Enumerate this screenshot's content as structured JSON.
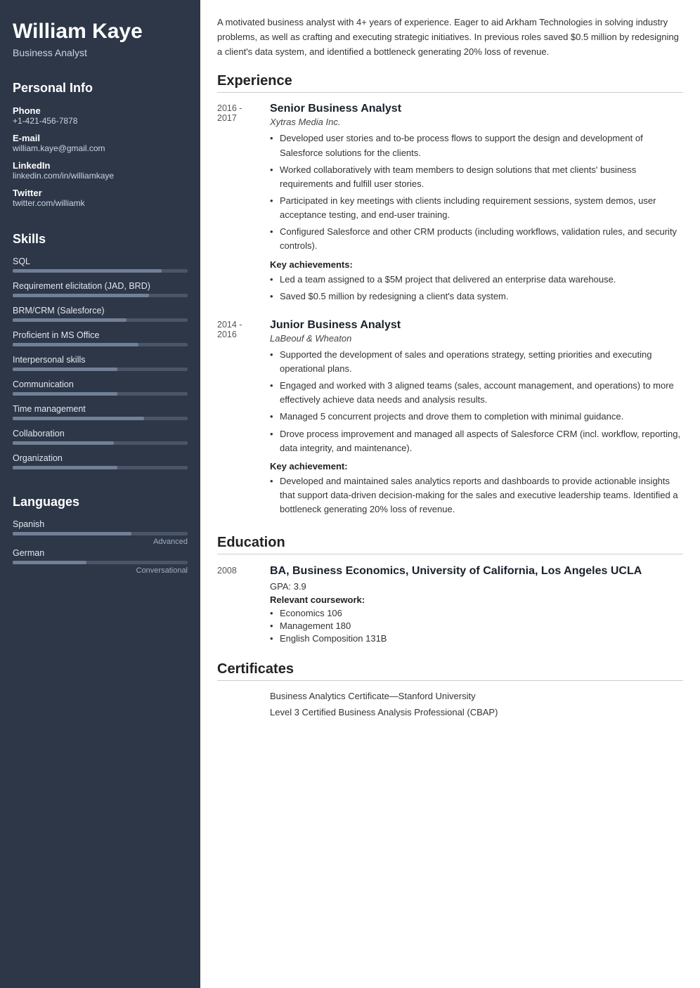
{
  "sidebar": {
    "name": "William Kaye",
    "title": "Business Analyst",
    "sections": {
      "personal_info": {
        "title": "Personal Info",
        "items": [
          {
            "label": "Phone",
            "value": "+1-421-456-7878"
          },
          {
            "label": "E-mail",
            "value": "william.kaye@gmail.com"
          },
          {
            "label": "LinkedIn",
            "value": "linkedin.com/in/williamkaye"
          },
          {
            "label": "Twitter",
            "value": "twitter.com/williamk"
          }
        ]
      },
      "skills": {
        "title": "Skills",
        "items": [
          {
            "name": "SQL",
            "fill_pct": 85
          },
          {
            "name": "Requirement elicitation (JAD, BRD)",
            "fill_pct": 78
          },
          {
            "name": "BRM/CRM (Salesforce)",
            "fill_pct": 65
          },
          {
            "name": "Proficient in MS Office",
            "fill_pct": 72
          },
          {
            "name": "Interpersonal skills",
            "fill_pct": 60
          },
          {
            "name": "Communication",
            "fill_pct": 60
          },
          {
            "name": "Time management",
            "fill_pct": 75
          },
          {
            "name": "Collaboration",
            "fill_pct": 58
          },
          {
            "name": "Organization",
            "fill_pct": 60
          }
        ]
      },
      "languages": {
        "title": "Languages",
        "items": [
          {
            "name": "Spanish",
            "fill_pct": 68,
            "level": "Advanced"
          },
          {
            "name": "German",
            "fill_pct": 42,
            "level": "Conversational"
          }
        ]
      }
    }
  },
  "main": {
    "summary": "A motivated business analyst with 4+ years of experience. Eager to aid Arkham Technologies in solving industry problems, as well as crafting and executing strategic initiatives. In previous roles saved $0.5 million by redesigning a client's data system, and identified a bottleneck generating 20% loss of revenue.",
    "experience": {
      "title": "Experience",
      "entries": [
        {
          "date_start": "2016 -",
          "date_end": "2017",
          "job_title": "Senior Business Analyst",
          "company": "Xytras Media Inc.",
          "bullets": [
            "Developed user stories and to-be process flows to support the design and development of Salesforce solutions for the clients.",
            "Worked collaboratively with team members to design solutions that met clients' business requirements and fulfill user stories.",
            "Participated in key meetings with clients including requirement sessions, system demos, user acceptance testing, and end-user training.",
            "Configured Salesforce and other CRM products (including workflows, validation rules, and security controls)."
          ],
          "achievements_title": "Key achievements:",
          "achievements": [
            "Led a team assigned to a $5M project that delivered an enterprise data warehouse.",
            "Saved $0.5 million by redesigning a client's data system."
          ]
        },
        {
          "date_start": "2014 -",
          "date_end": "2016",
          "job_title": "Junior Business Analyst",
          "company": "LaBeouf & Wheaton",
          "bullets": [
            "Supported the development of sales and operations strategy, setting priorities and executing operational plans.",
            "Engaged and worked with 3 aligned teams (sales, account management, and operations) to more effectively achieve data needs and analysis results.",
            "Managed 5 concurrent projects and drove them to completion with minimal guidance.",
            "Drove process improvement and managed all aspects of Salesforce CRM (incl. workflow, reporting, data integrity, and maintenance)."
          ],
          "achievements_title": "Key achievement:",
          "achievements": [
            "Developed and maintained sales analytics reports and dashboards to provide actionable insights that support data-driven decision-making for the sales and executive leadership teams. Identified a bottleneck generating 20% loss of revenue."
          ]
        }
      ]
    },
    "education": {
      "title": "Education",
      "entries": [
        {
          "date": "2008",
          "degree": "BA, Business Economics, University of California, Los Angeles UCLA",
          "gpa": "GPA: 3.9",
          "coursework_title": "Relevant coursework:",
          "coursework": [
            "Economics 106",
            "Management 180",
            "English Composition 131B"
          ]
        }
      ]
    },
    "certificates": {
      "title": "Certificates",
      "items": [
        "Business Analytics Certificate—Stanford University",
        "Level 3 Certified Business Analysis Professional (CBAP)"
      ]
    }
  }
}
